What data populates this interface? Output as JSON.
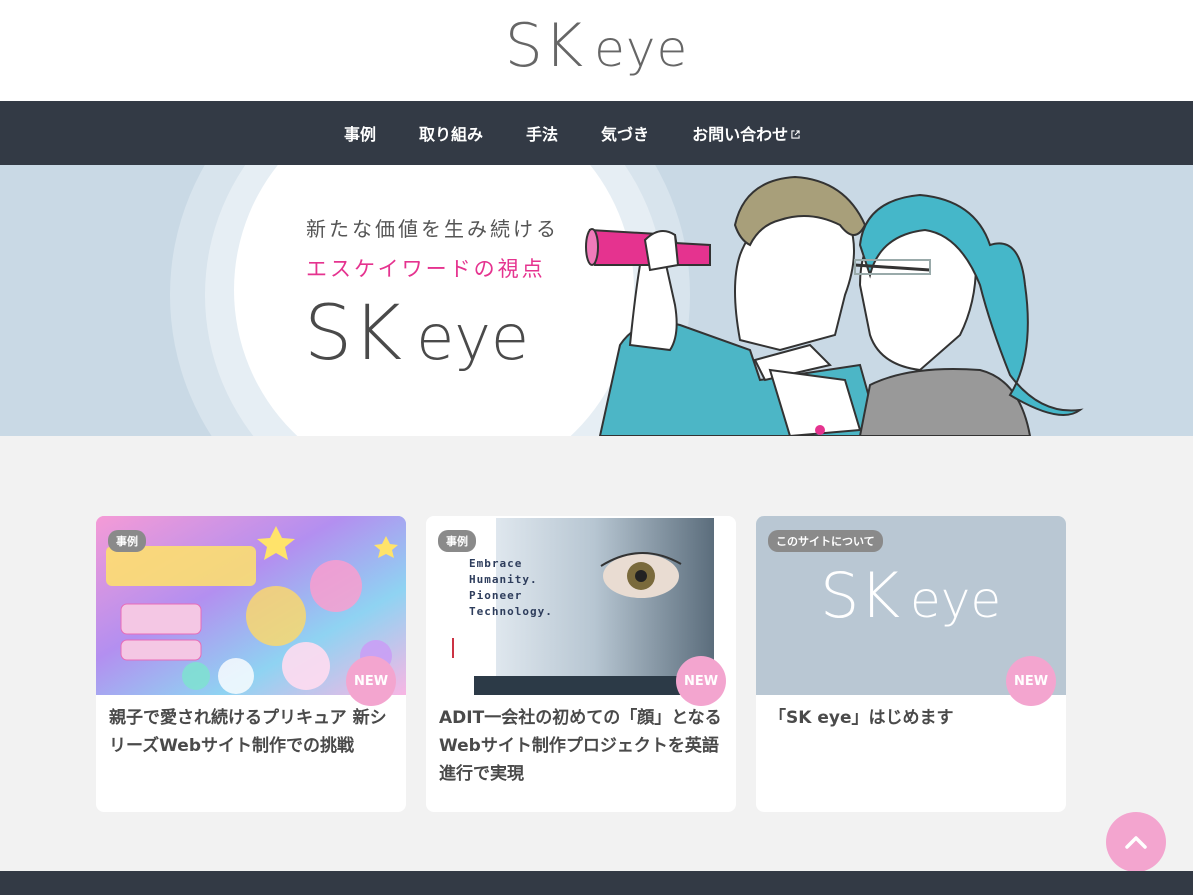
{
  "site": {
    "logo_sk": "SK",
    "logo_eye": "eye"
  },
  "nav": {
    "items": [
      {
        "label": "事例"
      },
      {
        "label": "取り組み"
      },
      {
        "label": "手法"
      },
      {
        "label": "気づき"
      },
      {
        "label": "お問い合わせ",
        "icon": "external-link-icon"
      }
    ]
  },
  "hero": {
    "line1": "新たな価値を生み続ける",
    "line2": "エスケイワードの視点",
    "logo_sk": "SK",
    "logo_eye": "eye",
    "accent_color": "#e5338f"
  },
  "cards": [
    {
      "tag": "事例",
      "badge": "NEW",
      "title": "親子で愛され続けるプリキュア 新シリーズWebサイト制作での挑戦"
    },
    {
      "tag": "事例",
      "badge": "NEW",
      "title": "ADIT一会社の初めての「顔」となるWebサイト制作プロジェクトを英語進行で実現",
      "thumb_text": [
        "Embrace",
        "Humanity.",
        "Pioneer",
        "Technology."
      ]
    },
    {
      "tag": "このサイトについて",
      "badge": "NEW",
      "title": "「SK eye」はじめます",
      "thumb_logo_sk": "SK",
      "thumb_logo_eye": "eye"
    }
  ],
  "colors": {
    "nav_bg": "#333a45",
    "badge_pink": "#f3a5cf",
    "page_bg": "#f2f2f2"
  },
  "back_to_top": {
    "icon": "chevron-up-icon"
  }
}
